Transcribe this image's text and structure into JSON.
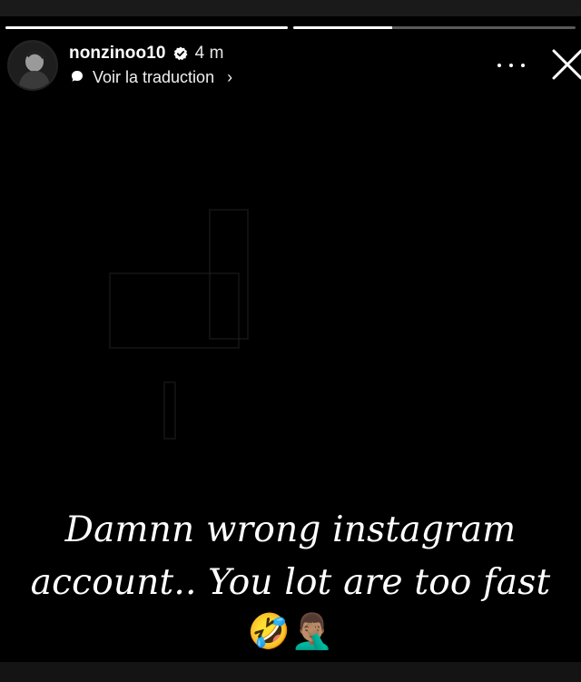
{
  "story": {
    "progress": [
      1.0,
      0.35
    ],
    "username": "nonzinoo10",
    "time": "4 m",
    "translate_label": "Voir la traduction",
    "translate_chevron": "›",
    "caption_line1": "Damnn wrong instagram",
    "caption_line2": "account.. You lot are too fast",
    "emojis": "🤣🤦🏽‍♂️"
  },
  "icons": {
    "verified": "verified-badge-icon",
    "translate": "speech-bubble-icon",
    "more": "more-horizontal-icon",
    "close": "close-icon"
  },
  "colors": {
    "background": "#000000",
    "text": "#ffffff",
    "progress_track": "rgba(255,255,255,0.35)"
  }
}
